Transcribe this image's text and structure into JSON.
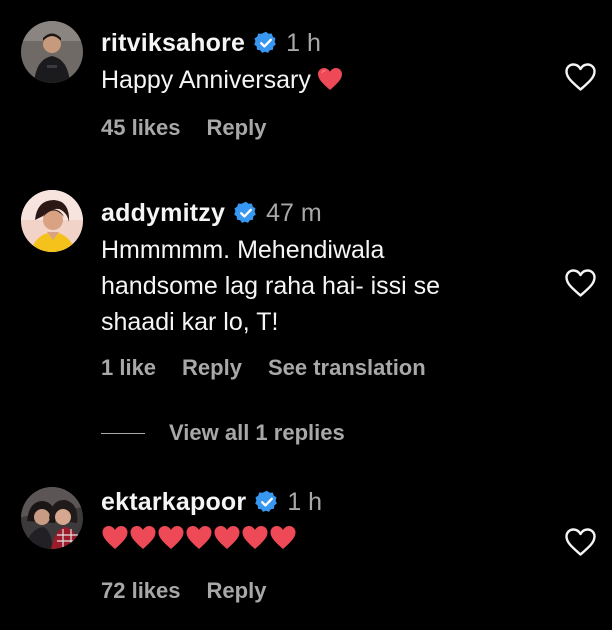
{
  "colors": {
    "background": "#000000",
    "text_primary": "#f5f5f5",
    "text_secondary": "#a8a8a8",
    "verified_badge": "#3897f0",
    "heart_red": "#ed4956"
  },
  "comments": [
    {
      "username": "ritviksahore",
      "time": "1 h",
      "text": "Happy Anniversary",
      "emoji": "red-heart",
      "likes": "45 likes",
      "reply_label": "Reply"
    },
    {
      "username": "addymitzy",
      "time": "47 m",
      "text_lines": [
        "Hmmmmm. Mehendiwala",
        "handsome lag raha hai- issi se",
        "shaadi kar lo, T!"
      ],
      "likes": "1 like",
      "reply_label": "Reply",
      "translation_label": "See translation",
      "view_replies_label": "View all 1 replies"
    },
    {
      "username": "ektarkapoor",
      "time": "1 h",
      "heart_count": 7,
      "likes": "72 likes",
      "reply_label": "Reply"
    }
  ]
}
